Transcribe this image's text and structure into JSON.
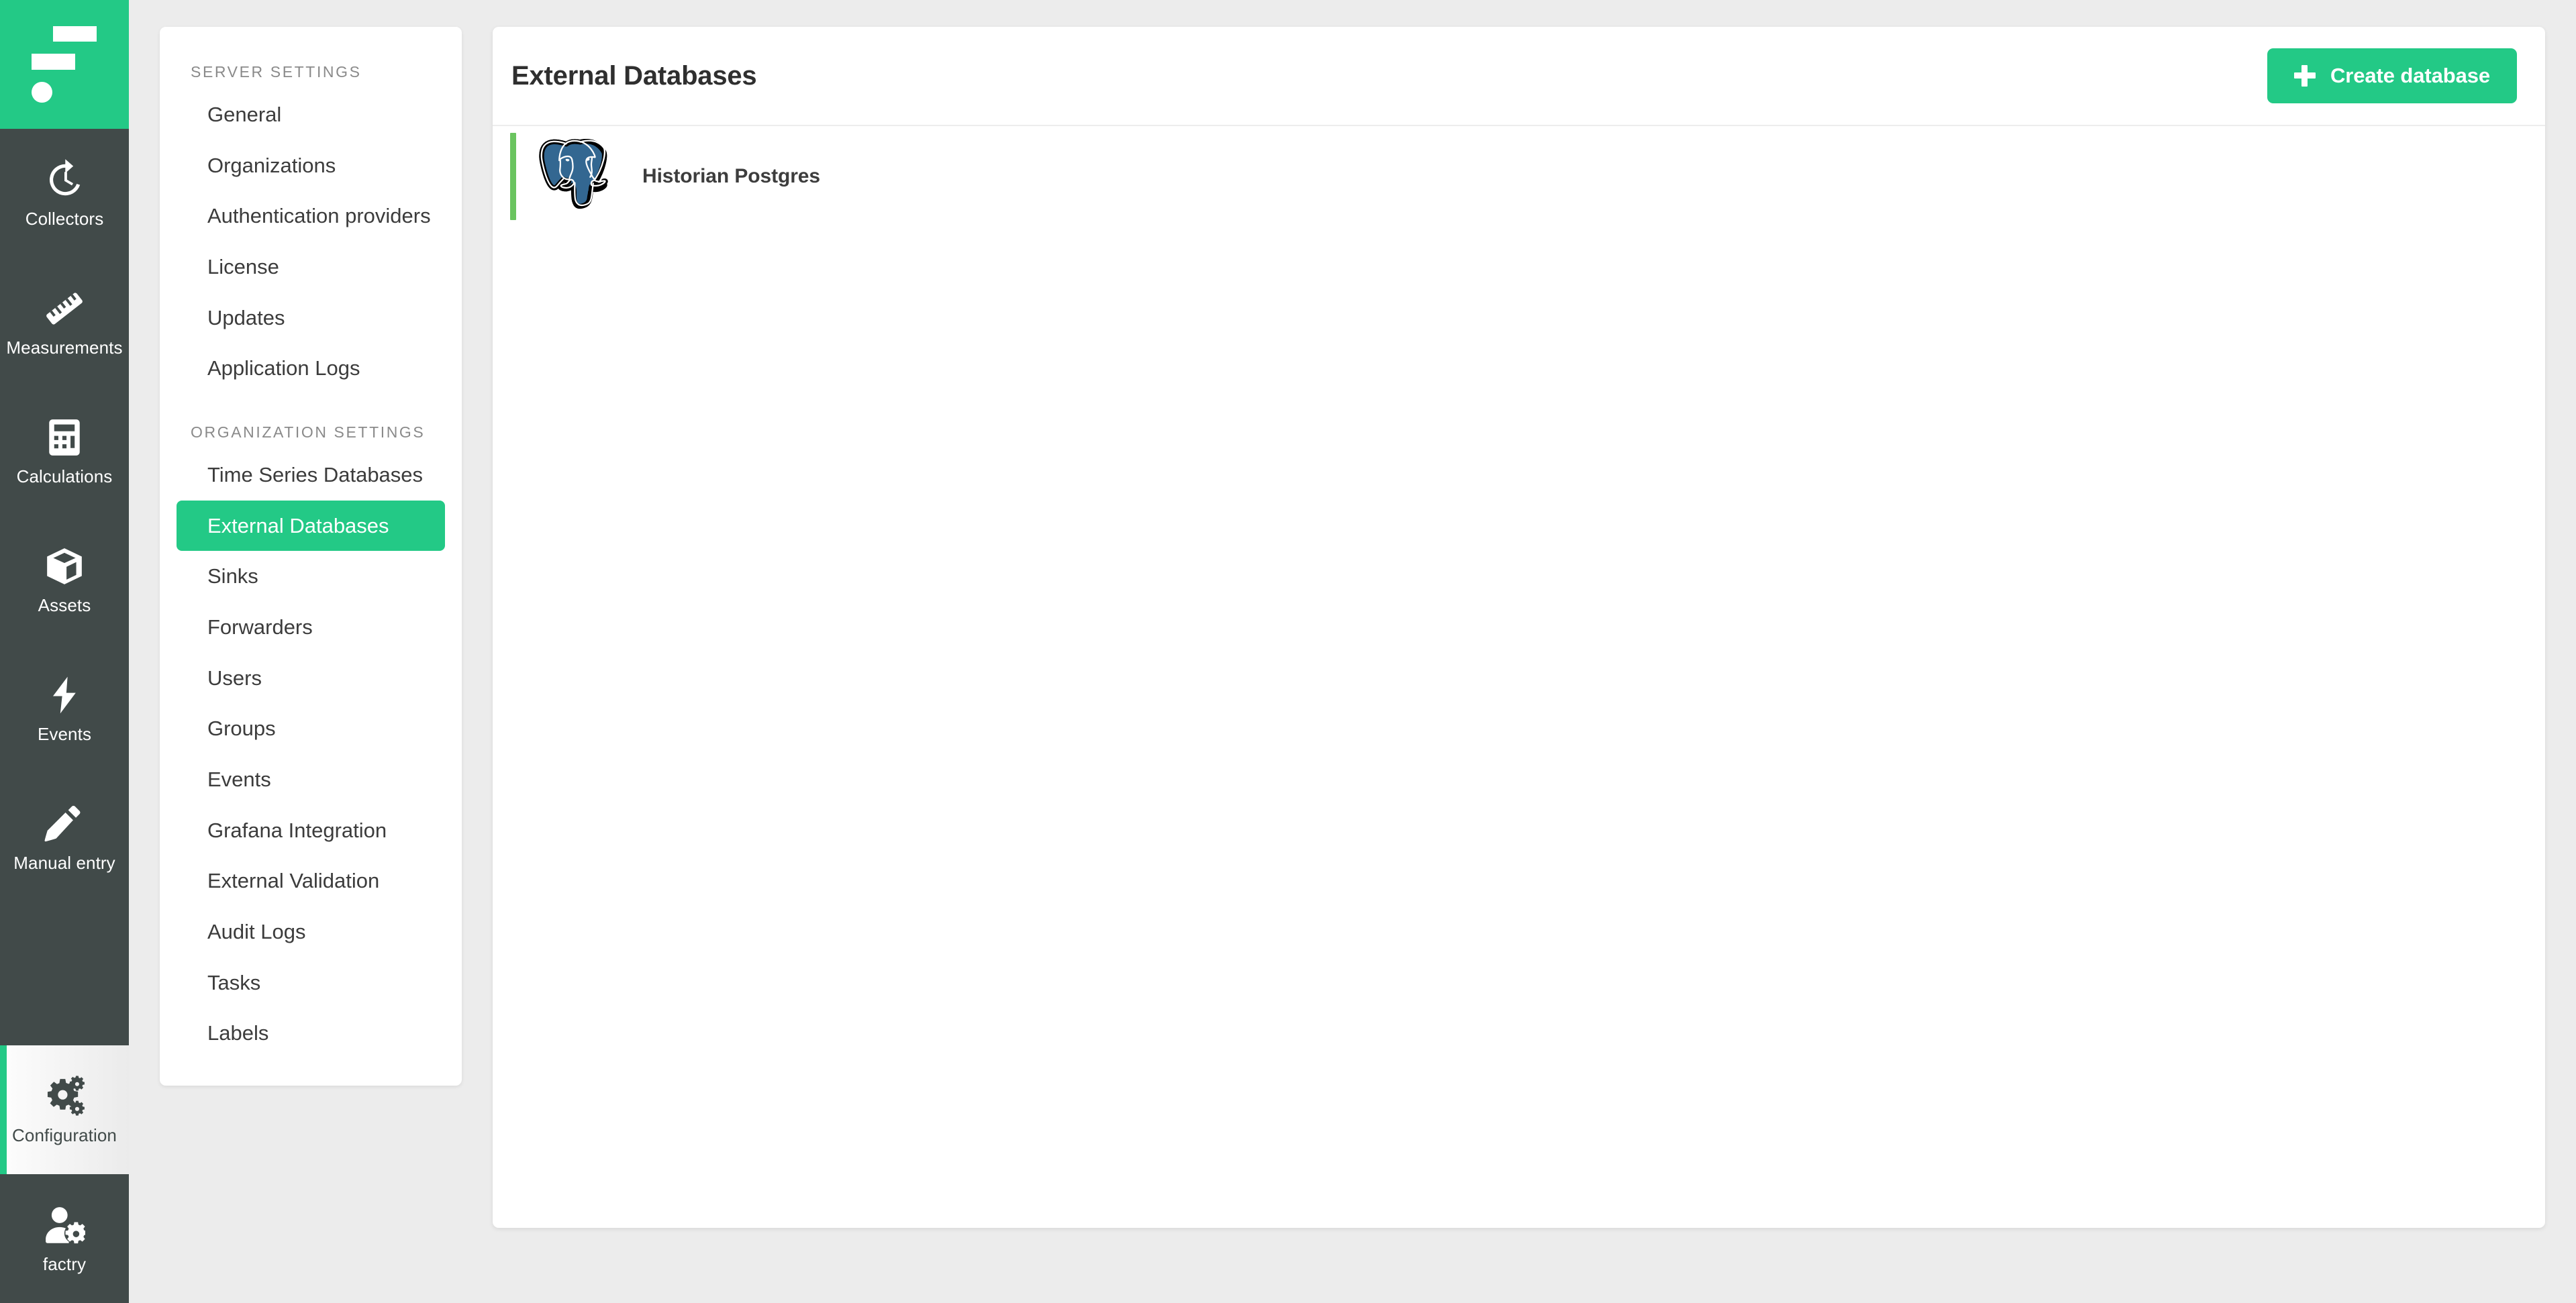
{
  "brand": {
    "logo_name": "factry-logo",
    "accent_color": "#23c986",
    "rail_color": "#414a49"
  },
  "rail": {
    "items": [
      {
        "label": "Collectors",
        "icon": "history-clock-icon",
        "active": false
      },
      {
        "label": "Measurements",
        "icon": "ruler-icon",
        "active": false
      },
      {
        "label": "Calculations",
        "icon": "calculator-icon",
        "active": false
      },
      {
        "label": "Assets",
        "icon": "cube-box-icon",
        "active": false
      },
      {
        "label": "Events",
        "icon": "lightning-bolt-icon",
        "active": false
      },
      {
        "label": "Manual entry",
        "icon": "pen-icon",
        "active": false
      },
      {
        "label": "Configuration",
        "icon": "gears-icon",
        "active": true
      },
      {
        "label": "factry",
        "icon": "user-gear-icon",
        "active": false
      }
    ]
  },
  "settings_panel": {
    "sections": [
      {
        "title": "Server settings",
        "items": [
          {
            "label": "General",
            "active": false
          },
          {
            "label": "Organizations",
            "active": false
          },
          {
            "label": "Authentication providers",
            "active": false
          },
          {
            "label": "License",
            "active": false
          },
          {
            "label": "Updates",
            "active": false
          },
          {
            "label": "Application Logs",
            "active": false
          }
        ]
      },
      {
        "title": "Organization settings",
        "items": [
          {
            "label": "Time Series Databases",
            "active": false
          },
          {
            "label": "External Databases",
            "active": true
          },
          {
            "label": "Sinks",
            "active": false
          },
          {
            "label": "Forwarders",
            "active": false
          },
          {
            "label": "Users",
            "active": false
          },
          {
            "label": "Groups",
            "active": false
          },
          {
            "label": "Events",
            "active": false
          },
          {
            "label": "Grafana Integration",
            "active": false
          },
          {
            "label": "External Validation",
            "active": false
          },
          {
            "label": "Audit Logs",
            "active": false
          },
          {
            "label": "Tasks",
            "active": false
          },
          {
            "label": "Labels",
            "active": false
          }
        ]
      }
    ]
  },
  "main": {
    "title": "External Databases",
    "create_button_label": "Create database",
    "databases": [
      {
        "name": "Historian Postgres",
        "logo": "postgresql-elephant-icon",
        "status_color": "#6ac45f"
      }
    ]
  }
}
